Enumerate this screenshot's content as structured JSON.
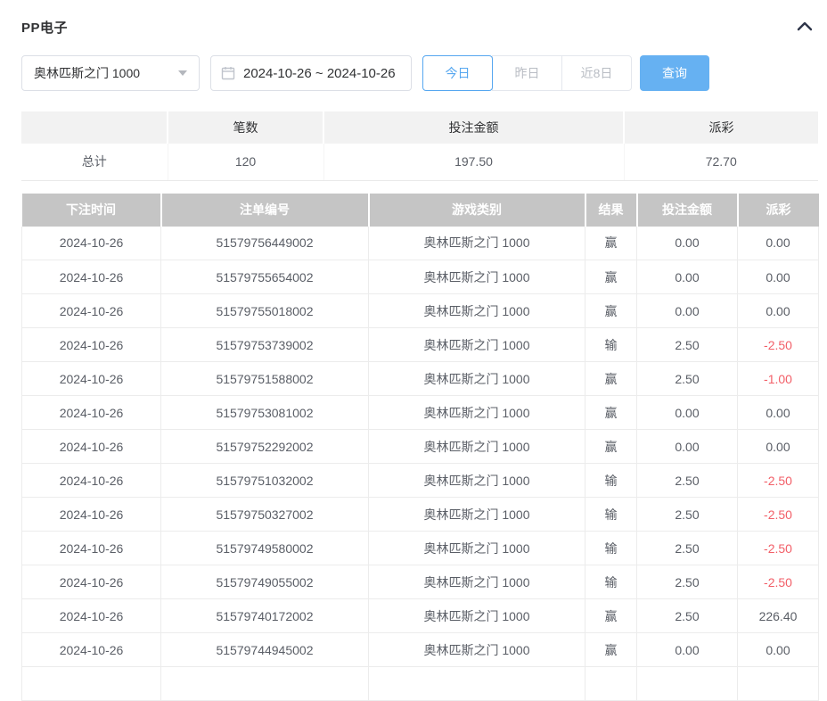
{
  "header": {
    "title": "PP电子",
    "collapse_icon": "chevron-up"
  },
  "filters": {
    "game_select": {
      "value": "奥林匹斯之门 1000"
    },
    "date_range": {
      "value": "2024-10-26 ~ 2024-10-26"
    },
    "quick_buttons": [
      {
        "label": "今日",
        "active": true
      },
      {
        "label": "昨日",
        "active": false
      },
      {
        "label": "近8日",
        "active": false
      }
    ],
    "search_label": "查询"
  },
  "summary": {
    "columns": [
      "",
      "笔数",
      "投注金额",
      "派彩"
    ],
    "total_label": "总计",
    "count": "120",
    "bet_amount": "197.50",
    "payout": "72.70"
  },
  "table": {
    "columns": [
      "下注时间",
      "注单编号",
      "游戏类别",
      "结果",
      "投注金额",
      "派彩"
    ],
    "rows": [
      [
        "2024-10-26",
        "51579756449002",
        "奥林匹斯之门 1000",
        "赢",
        "0.00",
        "0.00"
      ],
      [
        "2024-10-26",
        "51579755654002",
        "奥林匹斯之门 1000",
        "赢",
        "0.00",
        "0.00"
      ],
      [
        "2024-10-26",
        "51579755018002",
        "奥林匹斯之门 1000",
        "赢",
        "0.00",
        "0.00"
      ],
      [
        "2024-10-26",
        "51579753739002",
        "奥林匹斯之门 1000",
        "输",
        "2.50",
        "-2.50"
      ],
      [
        "2024-10-26",
        "51579751588002",
        "奥林匹斯之门 1000",
        "赢",
        "2.50",
        "-1.00"
      ],
      [
        "2024-10-26",
        "51579753081002",
        "奥林匹斯之门 1000",
        "赢",
        "0.00",
        "0.00"
      ],
      [
        "2024-10-26",
        "51579752292002",
        "奥林匹斯之门 1000",
        "赢",
        "0.00",
        "0.00"
      ],
      [
        "2024-10-26",
        "51579751032002",
        "奥林匹斯之门 1000",
        "输",
        "2.50",
        "-2.50"
      ],
      [
        "2024-10-26",
        "51579750327002",
        "奥林匹斯之门 1000",
        "输",
        "2.50",
        "-2.50"
      ],
      [
        "2024-10-26",
        "51579749580002",
        "奥林匹斯之门 1000",
        "输",
        "2.50",
        "-2.50"
      ],
      [
        "2024-10-26",
        "51579749055002",
        "奥林匹斯之门 1000",
        "输",
        "2.50",
        "-2.50"
      ],
      [
        "2024-10-26",
        "51579740172002",
        "奥林匹斯之门 1000",
        "赢",
        "2.50",
        "226.40"
      ],
      [
        "2024-10-26",
        "51579744945002",
        "奥林匹斯之门 1000",
        "赢",
        "0.00",
        "0.00"
      ]
    ]
  },
  "colors": {
    "accent_blue": "#56a7f0",
    "primary_button_bg": "#66b1f2",
    "negative_red": "#f25f68",
    "table_header_bg": "#c5c5c5",
    "summary_header_bg": "#f2f2f2"
  }
}
